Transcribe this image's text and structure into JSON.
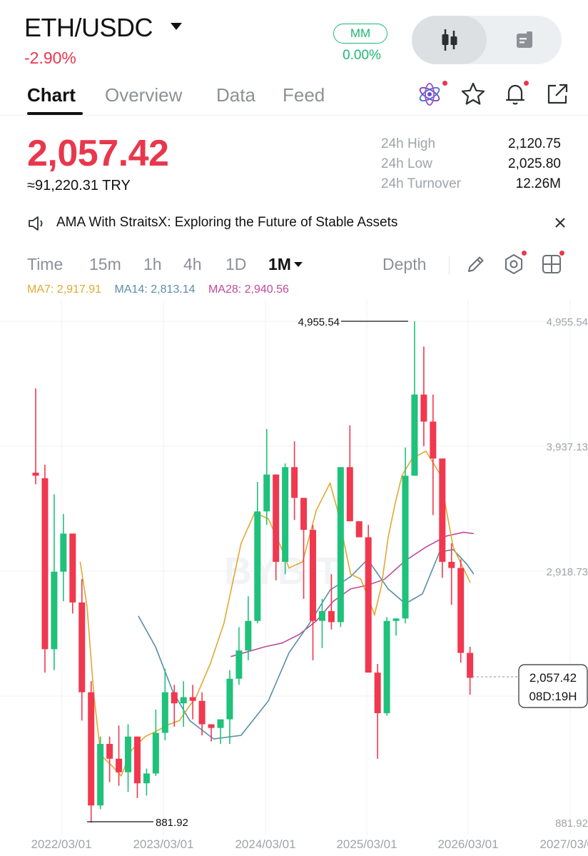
{
  "header": {
    "pair": "ETH/USDC",
    "change": "-2.90%",
    "mm_label": "MM",
    "mm_value": "0.00%"
  },
  "tabs": [
    "Chart",
    "Overview",
    "Data",
    "Feed"
  ],
  "ticker": {
    "last_price": "2,057.42",
    "fiat_value": "≈91,220.31 TRY",
    "stats": [
      {
        "label": "24h High",
        "value": "2,120.75"
      },
      {
        "label": "24h Low",
        "value": "2,025.80"
      },
      {
        "label": "24h Turnover",
        "value": "12.26M"
      }
    ]
  },
  "announcement": "AMA With StraitsX: Exploring the Future of Stable Assets",
  "toolbar": {
    "intervals": [
      "Time",
      "15m",
      "1h",
      "4h",
      "1D"
    ],
    "selected_interval": "1M",
    "depth": "Depth"
  },
  "ma": {
    "ma7": "MA7: 2,917.91",
    "ma14": "MA14: 2,813.14",
    "ma28": "MA28: 2,940.56"
  },
  "colors": {
    "up": "#1fc17b",
    "down": "#f0384f",
    "ma7": "#e0a832",
    "ma14": "#5a8ea8",
    "ma28": "#c04a9c"
  },
  "chart_data": {
    "type": "candlestick",
    "interval": "1M",
    "y_ticks": [
      "4,955.54",
      "3,937.13",
      "2,918.73",
      "881.92"
    ],
    "x_ticks": [
      "2022/03/01",
      "2023/03/01",
      "2024/03/01",
      "2025/03/01",
      "2026/03/01",
      "2027/03/01"
    ],
    "high_marker": "4,955.54",
    "low_marker": "881.92",
    "last_price_label": "2,057.42",
    "countdown_label": "08D:19H",
    "watermark": "BYBIT",
    "candles": [
      [
        3725,
        4410,
        3630,
        3700
      ],
      [
        3680,
        3790,
        2100,
        2290
      ],
      [
        2290,
        3550,
        2120,
        2920
      ],
      [
        2920,
        3390,
        2680,
        3230
      ],
      [
        3230,
        3210,
        2580,
        2670
      ],
      [
        2670,
        2860,
        1710,
        1940
      ],
      [
        1940,
        2030,
        880,
        1020
      ],
      [
        1020,
        1580,
        990,
        1520
      ],
      [
        1520,
        1580,
        1210,
        1400
      ],
      [
        1400,
        1670,
        1180,
        1290
      ],
      [
        1290,
        1680,
        1130,
        1580
      ],
      [
        1580,
        1480,
        1080,
        1200
      ],
      [
        1200,
        1320,
        1100,
        1280
      ],
      [
        1280,
        1800,
        1260,
        1610
      ],
      [
        1610,
        2130,
        1550,
        1940
      ],
      [
        1940,
        2000,
        1660,
        1850
      ],
      [
        1850,
        2030,
        1660,
        1900
      ],
      [
        1900,
        2000,
        1720,
        1870
      ],
      [
        1870,
        1940,
        1590,
        1680
      ],
      [
        1680,
        1680,
        1540,
        1650
      ],
      [
        1650,
        1720,
        1520,
        1720
      ],
      [
        1720,
        2120,
        1520,
        2050
      ],
      [
        2050,
        2470,
        2000,
        2280
      ],
      [
        2280,
        2720,
        2200,
        2520
      ],
      [
        2520,
        3650,
        2500,
        3410
      ],
      [
        3410,
        4080,
        3300,
        3710
      ],
      [
        3710,
        3600,
        2850,
        3000
      ],
      [
        3000,
        3800,
        2900,
        3770
      ],
      [
        3770,
        3980,
        3340,
        3520
      ],
      [
        3520,
        3500,
        2700,
        3260
      ],
      [
        3260,
        3300,
        2200,
        2520
      ],
      [
        2520,
        2700,
        2300,
        2600
      ],
      [
        2600,
        2900,
        2450,
        2510
      ],
      [
        2510,
        3700,
        2470,
        3770
      ],
      [
        3770,
        4110,
        3420,
        3330
      ],
      [
        3330,
        3290,
        3200,
        3200
      ],
      [
        3200,
        3300,
        2200,
        2100
      ],
      [
        2100,
        2170,
        1400,
        1770
      ],
      [
        1770,
        2550,
        1750,
        2520
      ],
      [
        2520,
        2490,
        2400,
        2540
      ],
      [
        2540,
        3930,
        2500,
        3700
      ],
      [
        3700,
        4955,
        3700,
        4360
      ],
      [
        4360,
        4750,
        3940,
        4140
      ],
      [
        4140,
        4360,
        3380,
        3840
      ],
      [
        3840,
        3590,
        2870,
        3000
      ],
      [
        3000,
        3150,
        2650,
        2950
      ],
      [
        2950,
        3020,
        2180,
        2260
      ],
      [
        2260,
        2310,
        1920,
        2057.42
      ]
    ],
    "ma7": [
      [
        13,
        3000
      ],
      [
        15,
        2640
      ],
      [
        17,
        1920
      ],
      [
        19,
        1430
      ],
      [
        22,
        1350
      ],
      [
        25,
        1260
      ],
      [
        28,
        1470
      ],
      [
        32,
        1580
      ],
      [
        35,
        1620
      ],
      [
        39,
        1680
      ],
      [
        42,
        1710
      ],
      [
        47,
        1910
      ],
      [
        51,
        2170
      ],
      [
        55,
        2500
      ],
      [
        60,
        3150
      ],
      [
        64,
        3400
      ],
      [
        68,
        3350
      ],
      [
        72,
        3100
      ],
      [
        74,
        2950
      ],
      [
        78,
        3000
      ],
      [
        82,
        3420
      ],
      [
        86,
        3640
      ],
      [
        88,
        3440
      ],
      [
        92,
        2900
      ],
      [
        95,
        2860
      ],
      [
        97,
        2720
      ],
      [
        99,
        2570
      ],
      [
        101,
        2800
      ],
      [
        103,
        3200
      ],
      [
        105,
        3470
      ],
      [
        107,
        3700
      ],
      [
        110,
        3840
      ],
      [
        114,
        3900
      ],
      [
        118,
        3720
      ],
      [
        122,
        3120
      ],
      [
        127,
        2830
      ]
    ],
    "ma14": [
      [
        30,
        2560
      ],
      [
        35,
        2310
      ],
      [
        40,
        1950
      ],
      [
        45,
        1710
      ],
      [
        52,
        1560
      ],
      [
        60,
        1590
      ],
      [
        68,
        1870
      ],
      [
        74,
        2260
      ],
      [
        80,
        2500
      ],
      [
        86,
        2770
      ],
      [
        92,
        2880
      ],
      [
        97,
        3020
      ],
      [
        103,
        2780
      ],
      [
        108,
        2660
      ],
      [
        113,
        2740
      ],
      [
        118,
        3080
      ],
      [
        122,
        3100
      ],
      [
        126,
        2980
      ],
      [
        128,
        2900
      ]
    ],
    "ma28": [
      [
        57,
        2230
      ],
      [
        62,
        2270
      ],
      [
        67,
        2310
      ],
      [
        72,
        2340
      ],
      [
        77,
        2410
      ],
      [
        82,
        2520
      ],
      [
        87,
        2680
      ],
      [
        92,
        2780
      ],
      [
        97,
        2810
      ],
      [
        102,
        2860
      ],
      [
        108,
        3010
      ],
      [
        114,
        3120
      ],
      [
        120,
        3210
      ],
      [
        125,
        3240
      ],
      [
        128,
        3230
      ]
    ]
  }
}
